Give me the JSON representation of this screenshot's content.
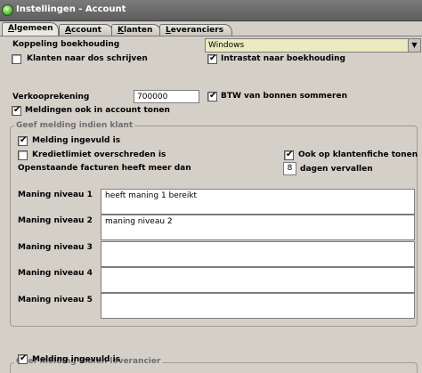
{
  "window": {
    "title": "Instellingen - Account"
  },
  "tabs": [
    {
      "mnemonic": "A",
      "rest": "lgemeen"
    },
    {
      "mnemonic": "A",
      "rest": "ccount"
    },
    {
      "mnemonic": "K",
      "rest": "lanten"
    },
    {
      "mnemonic": "L",
      "rest": "everanciers"
    }
  ],
  "general": {
    "koppeling_label": "Koppeling boekhouding",
    "koppeling_value": "Windows",
    "klanten_dos_label": "Klanten naar dos schrijven",
    "klanten_dos_checked": false,
    "intrastat_label": "Intrastat naar boekhouding",
    "intrastat_checked": true,
    "verkooprekening_label": "Verkooprekening",
    "verkooprekening_value": "700000",
    "btw_label": "BTW van bonnen sommeren",
    "btw_checked": true,
    "meldingen_label": "Meldingen ook in account tonen",
    "meldingen_checked": true
  },
  "klant_group": {
    "legend": "Geef melding indien klant",
    "ingevuld_label": "Melding ingevuld is",
    "ingevuld_checked": true,
    "krediet_label": "Kredietlimiet overschreden is",
    "krediet_checked": false,
    "klantenfiche_label": "Ook op klantenfiche tonen",
    "klantenfiche_checked": true,
    "facturen_label": "Openstaande facturen heeft meer dan",
    "facturen_days": "8",
    "dagen_label": "dagen vervallen",
    "maning": [
      {
        "label": "Maning niveau 1",
        "value": "heeft maning 1 bereikt"
      },
      {
        "label": "Maning niveau 2",
        "value": "maning niveau 2"
      },
      {
        "label": "Maning niveau 3",
        "value": ""
      },
      {
        "label": "Maning niveau 4",
        "value": ""
      },
      {
        "label": "Maning niveau 5",
        "value": ""
      }
    ]
  },
  "leverancier_group": {
    "legend": "Geef melding indien leverancier",
    "ingevuld_label": "Melding ingevuld is",
    "ingevuld_checked": true
  },
  "icons": {
    "app": "app-globe-icon",
    "dropdown": "chevron-down-icon",
    "check": "checkmark-icon"
  },
  "colors": {
    "titlebar": "#6a6a6a",
    "combo_bg": "#ecebc0",
    "panel": "#d4d0c8"
  }
}
